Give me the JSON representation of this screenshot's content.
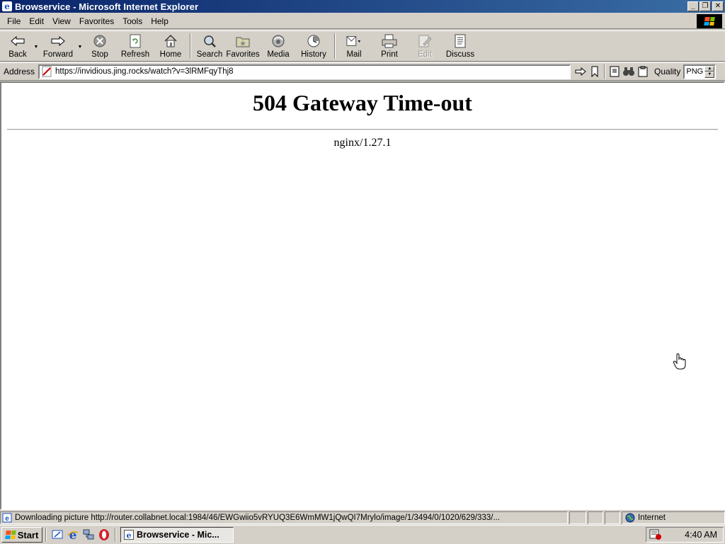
{
  "window": {
    "title": "Browservice - Microsoft Internet Explorer",
    "controls": [
      "minimize",
      "restore",
      "close"
    ]
  },
  "menubar": {
    "items": [
      {
        "label": "File"
      },
      {
        "label": "Edit"
      },
      {
        "label": "View"
      },
      {
        "label": "Favorites"
      },
      {
        "label": "Tools"
      },
      {
        "label": "Help"
      }
    ]
  },
  "toolbar": {
    "back": "Back",
    "forward": "Forward",
    "stop": "Stop",
    "refresh": "Refresh",
    "home": "Home",
    "search": "Search",
    "favorites": "Favorites",
    "media": "Media",
    "history": "History",
    "mail": "Mail",
    "print": "Print",
    "edit": "Edit",
    "discuss": "Discuss"
  },
  "address": {
    "label": "Address",
    "url": "https://invidious.jing.rocks/watch?v=3lRMFqyThj8",
    "quality_label": "Quality",
    "quality_value": "PNG"
  },
  "page": {
    "heading": "504 Gateway Time-out",
    "server": "nginx/1.27.1"
  },
  "statusbar": {
    "message": "Downloading picture http://router.collabnet.local:1984/46/EWGwiio5vRYUQ3E6WmMW1jQwQI7Mrylo/image/1/3494/0/1020/629/333/...",
    "zone": "Internet"
  },
  "taskbar": {
    "start": "Start",
    "task": "Browservice - Mic...",
    "clock": "4:40 AM"
  },
  "colors": {
    "titlebar_start": "#0a246a",
    "titlebar_end": "#3a6ea5",
    "chrome": "#d4d0c8"
  }
}
